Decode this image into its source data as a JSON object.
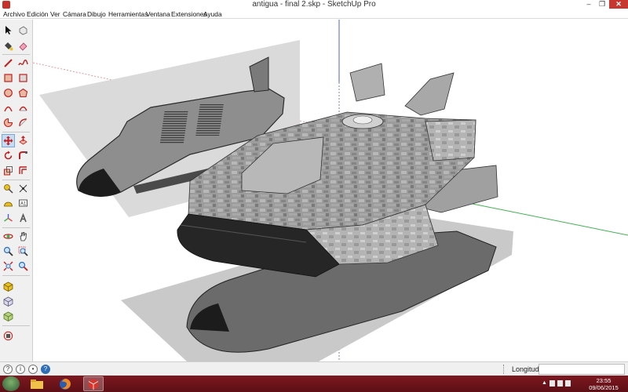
{
  "window": {
    "title": "antigua - final 2.skp - SketchUp Pro",
    "minimize_icon": "minimize-icon",
    "maximize_icon": "restore-icon",
    "close_icon": "close-icon"
  },
  "menu": {
    "items": [
      "Archivo",
      "Edición",
      "Ver",
      "Cámara",
      "Dibujo",
      "Herramientas",
      "Ventana",
      "Extensiones",
      "Ayuda"
    ]
  },
  "toolbar": {
    "tools": [
      "select-icon",
      "eraser-shape-icon",
      "paint-bucket-icon",
      "eraser-icon",
      "line-icon",
      "freehand-icon",
      "rectangle-icon",
      "rotated-rectangle-icon",
      "circle-icon",
      "polygon-icon",
      "arc-icon",
      "two-point-arc-icon",
      "pie-icon",
      "three-point-arc-icon",
      "move-icon",
      "push-pull-icon",
      "rotate-icon",
      "follow-me-icon",
      "scale-icon",
      "offset-icon",
      "tape-measure-icon",
      "dimension-icon",
      "protractor-icon",
      "text-icon",
      "axes-icon",
      "3d-text-icon",
      "orbit-icon",
      "pan-icon",
      "zoom-icon",
      "zoom-window-icon",
      "zoom-extents-icon",
      "position-camera-icon",
      "warehouse-icon",
      "components-icon",
      "extension-warehouse-icon",
      "styles-icon"
    ],
    "active_tool": "move-icon"
  },
  "status": {
    "measurement_label": "Longitud",
    "measurement_value": ""
  },
  "taskbar": {
    "apps": [
      "file-explorer-icon",
      "firefox-icon",
      "sketchup-icon"
    ],
    "active_app": "sketchup-icon",
    "time": "23:55",
    "date": "09/06/2015"
  },
  "colors": {
    "taskbar": "#7e1820",
    "close_button": "#c7372f",
    "axis_red": "#e04b4b",
    "axis_green": "#3fb34f",
    "axis_blue": "#4a63d6"
  }
}
